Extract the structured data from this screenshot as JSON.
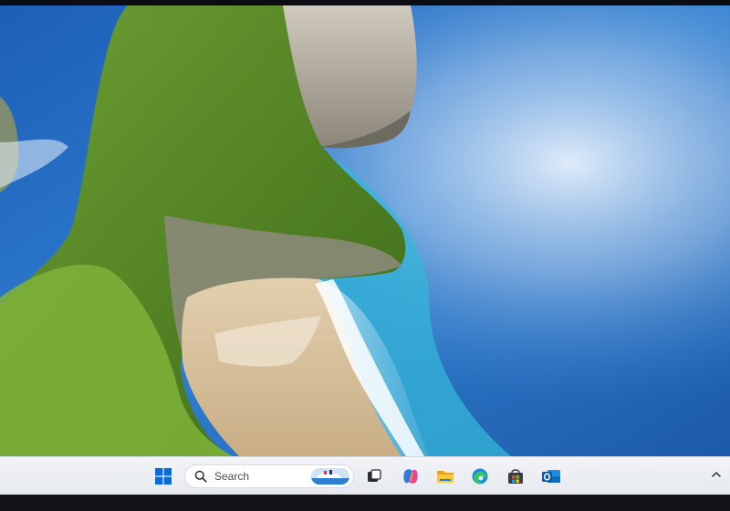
{
  "desktop": {
    "wallpaper_icon": "landscape-wallpaper"
  },
  "taskbar": {
    "start_icon": "windows-start-icon",
    "search": {
      "placeholder": "Search",
      "icon": "search-icon"
    },
    "pinned": [
      {
        "name": "task-view",
        "icon": "task-view-icon"
      },
      {
        "name": "copilot",
        "icon": "copilot-icon"
      },
      {
        "name": "file-explorer",
        "icon": "folder-icon"
      },
      {
        "name": "edge",
        "icon": "edge-icon"
      },
      {
        "name": "store",
        "icon": "store-icon"
      },
      {
        "name": "outlook",
        "icon": "outlook-icon"
      }
    ],
    "tray_icon": "chevron-up-icon"
  },
  "colors": {
    "taskbar_bg": "#eceef2",
    "accent": "#0067c0",
    "ocean": "#1f6fc4",
    "cliff": "#5f8f2a",
    "sand": "#d9c4a3"
  }
}
